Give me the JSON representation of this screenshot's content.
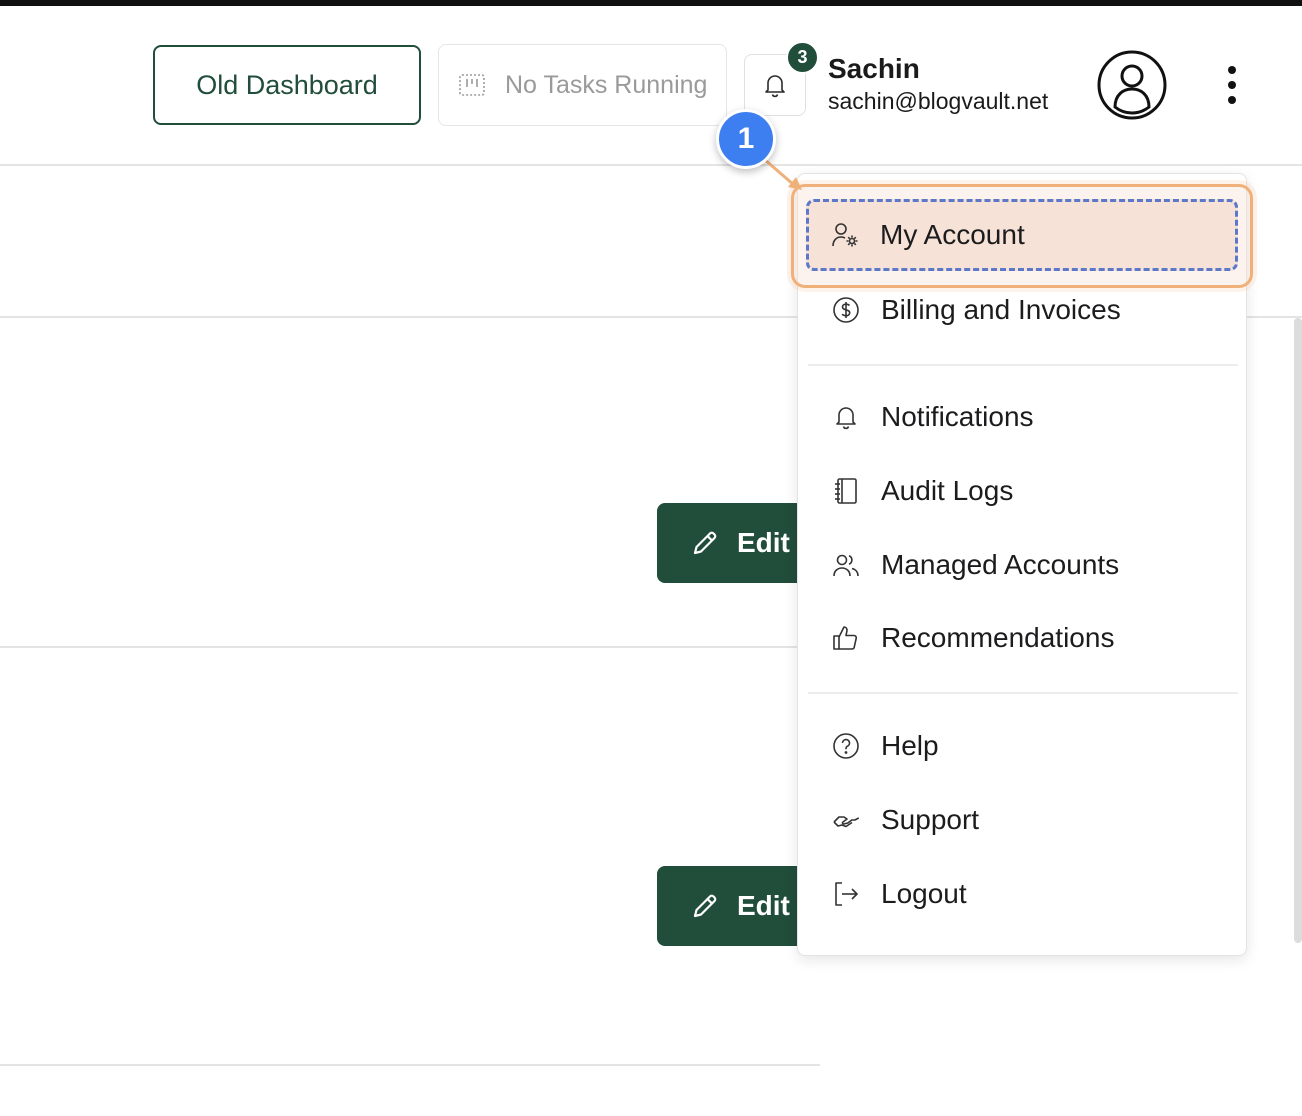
{
  "header": {
    "old_dashboard_label": "Old Dashboard",
    "tasks_label": "No Tasks Running",
    "notification_count": "3",
    "user": {
      "name": "Sachin",
      "email": "sachin@blogvault.net"
    }
  },
  "content": {
    "edit_label_1": "Edit",
    "edit_label_2": "Edit"
  },
  "menu": {
    "items": [
      {
        "label": "My Account",
        "icon": "user-gear-icon"
      },
      {
        "label": "Billing and Invoices",
        "icon": "dollar-circle-icon"
      },
      {
        "label": "Notifications",
        "icon": "bell-icon"
      },
      {
        "label": "Audit Logs",
        "icon": "notebook-icon"
      },
      {
        "label": "Managed Accounts",
        "icon": "users-icon"
      },
      {
        "label": "Recommendations",
        "icon": "thumbs-up-icon"
      },
      {
        "label": "Help",
        "icon": "question-circle-icon"
      },
      {
        "label": "Support",
        "icon": "handshake-icon"
      },
      {
        "label": "Logout",
        "icon": "logout-icon"
      }
    ]
  },
  "annotation": {
    "step": "1"
  },
  "colors": {
    "brand": "#214d3b",
    "highlight": "#f0b07a",
    "step_badge": "#3d7ff0"
  }
}
